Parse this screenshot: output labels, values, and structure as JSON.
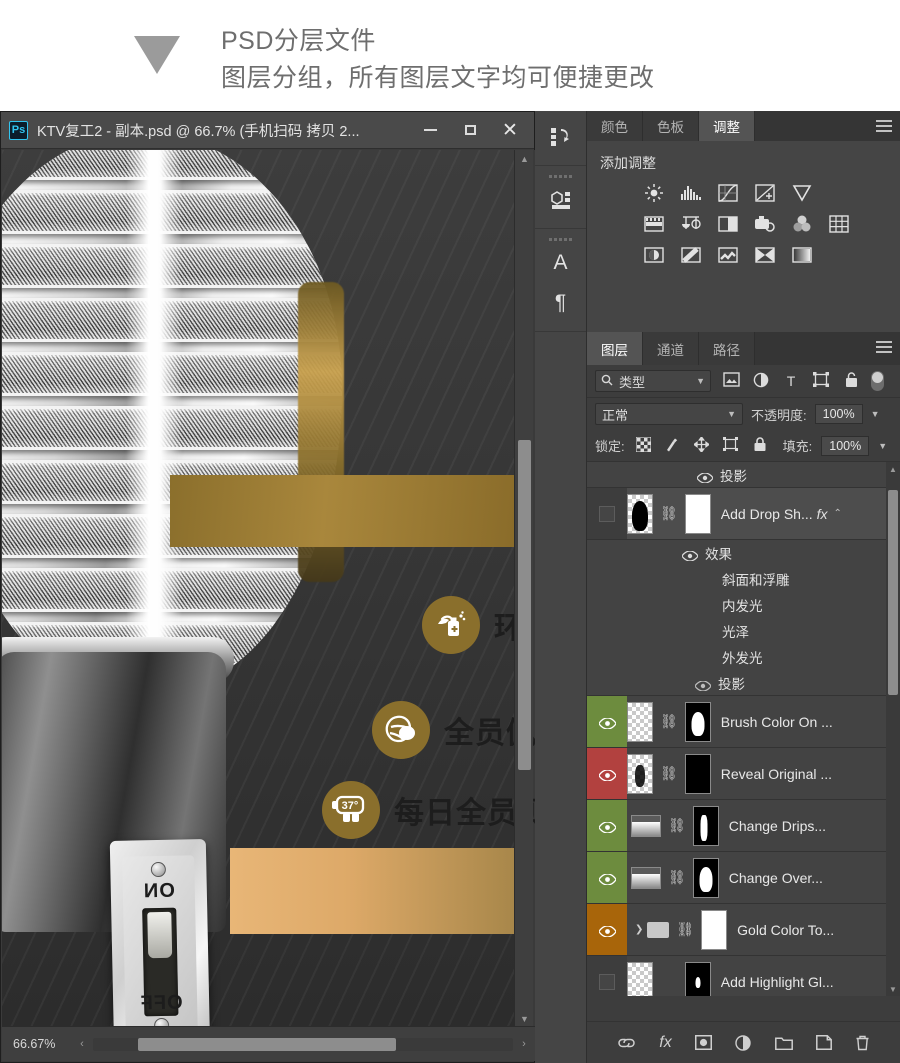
{
  "promo": {
    "line1": "PSD分层文件",
    "line2": "图层分组，所有图层文字均可便捷更改",
    "arrow_icon": "triangle-down-icon"
  },
  "window": {
    "app_badge": "Ps",
    "title": "KTV复工2 - 副本.psd @ 66.7% (手机扫码 拷贝 2...",
    "minimize_label": "",
    "maximize_label": "",
    "close_label": "✕"
  },
  "canvas": {
    "switch": {
      "on_label": "ON",
      "off_label": "OFF"
    },
    "icon_rows": [
      {
        "icon": "hand-sanitizer-icon",
        "text": "环"
      },
      {
        "icon": "face-mask-icon",
        "text": "全员佩"
      },
      {
        "icon": "thermometer-gun-icon",
        "text": "每日全员测",
        "badge": "37°"
      }
    ],
    "colors": {
      "banner_gold": "#a9873c",
      "banner_tan": "#e8b677",
      "icon_circle": "#8a6f2c"
    }
  },
  "statusbar": {
    "zoom": "66.67%",
    "scroll_left_icon": "chevron-left-icon",
    "scroll_right_icon": "chevron-right-icon"
  },
  "rail": {
    "items": [
      {
        "name": "history-icon",
        "glyph": "↺"
      },
      {
        "name": "properties-icon",
        "glyph": "❏"
      },
      {
        "name": "character-icon",
        "glyph": "A"
      },
      {
        "name": "paragraph-icon",
        "glyph": "¶"
      }
    ]
  },
  "adjustments": {
    "tabs": [
      {
        "label": "颜色",
        "active": false
      },
      {
        "label": "色板",
        "active": false
      },
      {
        "label": "调整",
        "active": true
      }
    ],
    "menu_icon": "panel-menu-icon",
    "title": "添加调整",
    "rows": [
      [
        "brightness-contrast-icon",
        "levels-icon",
        "curves-icon",
        "exposure-icon",
        "vibrance-icon"
      ],
      [
        "hue-saturation-icon",
        "color-balance-icon",
        "black-white-icon",
        "photo-filter-icon",
        "channel-mixer-icon",
        "color-lookup-icon"
      ],
      [
        "invert-icon",
        "posterize-icon",
        "threshold-icon",
        "gradient-map-icon",
        "selective-color-icon"
      ]
    ]
  },
  "layers": {
    "tabs": [
      {
        "label": "图层",
        "active": true
      },
      {
        "label": "通道",
        "active": false
      },
      {
        "label": "路径",
        "active": false
      }
    ],
    "menu_icon": "panel-menu-icon",
    "filter": {
      "search_icon": "search-icon",
      "kind_value": "类型",
      "chevron_icon": "chevron-down-icon",
      "filter_icons": [
        "image-filter-icon",
        "adjustment-filter-icon",
        "type-filter-icon",
        "shape-filter-icon",
        "smart-object-filter-icon"
      ],
      "toggle_icon": "filter-toggle-switch"
    },
    "blend": {
      "mode_value": "正常",
      "mode_chevron": "chevron-down-icon",
      "opacity_label": "不透明度:",
      "opacity_value": "100%",
      "opacity_chevron": "chevron-down-icon"
    },
    "lock": {
      "label": "锁定:",
      "icons": [
        "lock-transparency-icon",
        "lock-image-icon",
        "lock-position-icon",
        "lock-artboard-icon",
        "lock-all-icon"
      ],
      "fill_label": "填充:",
      "fill_value": "100%",
      "fill_chevron": "chevron-down-icon"
    },
    "top_effect": {
      "eye_icon": "eye-icon",
      "name": "投影"
    },
    "rows": [
      {
        "kind": "layer",
        "label_color": "none",
        "visible": false,
        "thumb": "figure-transparent",
        "mask": "white",
        "name": "Add Drop Sh...",
        "fx": "fx",
        "caret": "chevron-up-icon",
        "effects_group": "效果",
        "effects": [
          "斜面和浮雕",
          "内发光",
          "光泽",
          "外发光"
        ],
        "effects_last": "投影"
      },
      {
        "kind": "layer",
        "label_color": "#6d8c3e",
        "visible": true,
        "thumb": "transparent",
        "mask": "black-white-blob",
        "name": "Brush Color On ..."
      },
      {
        "kind": "layer",
        "label_color": "#b2413f",
        "visible": true,
        "thumb": "speckle-transparent",
        "mask": "black",
        "name": "Reveal Original ..."
      },
      {
        "kind": "layer",
        "label_color": "#6d8c3e",
        "visible": true,
        "thumb": "gradient",
        "mask": "black-drip",
        "name": "Change Drips..."
      },
      {
        "kind": "layer",
        "label_color": "#6d8c3e",
        "visible": true,
        "thumb": "gradient",
        "mask": "black-white-blob",
        "name": "Change Over..."
      },
      {
        "kind": "group",
        "label_color": "#a8650a",
        "visible": true,
        "thumb": "folder",
        "mask": "white",
        "name": "Gold Color To...",
        "arrow": "chevron-right-icon"
      },
      {
        "kind": "layer",
        "label_color": "none",
        "visible": false,
        "thumb": "transparent",
        "mask": "black-small-blob",
        "name": "Add Highlight Gl..."
      }
    ],
    "footer_icons": [
      {
        "name": "link-layers-icon",
        "glyph": "⛓"
      },
      {
        "name": "layer-style-fx-icon",
        "glyph": "fx"
      },
      {
        "name": "add-layer-mask-icon",
        "glyph": "◉"
      },
      {
        "name": "new-fill-adjustment-icon",
        "glyph": "◐"
      },
      {
        "name": "new-group-icon",
        "glyph": "▭"
      },
      {
        "name": "new-layer-icon",
        "glyph": "❐"
      },
      {
        "name": "delete-layer-icon",
        "glyph": "🗑"
      }
    ]
  }
}
